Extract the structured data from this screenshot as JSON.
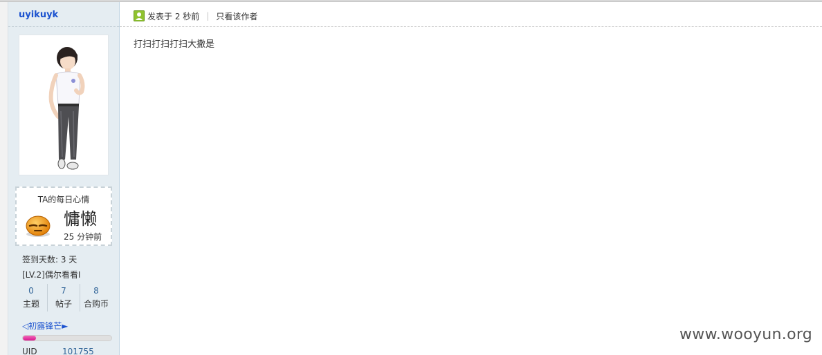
{
  "author": {
    "username": "uyikuyk"
  },
  "mood": {
    "title": "TA的每日心情",
    "word": "慵懒",
    "time": "25 分钟前",
    "icon": "lazy-face-icon"
  },
  "profile": {
    "checkin": "签到天数: 3 天",
    "level": "[LV.2]偶尔看看I",
    "stats": [
      {
        "value": "0",
        "label": "主题"
      },
      {
        "value": "7",
        "label": "帖子"
      },
      {
        "value": "8",
        "label": "合购币"
      }
    ],
    "medal": "◁初露锋芒►",
    "progress_fraction": 0.15,
    "uid_label": "UID",
    "uid_value": "101755"
  },
  "post": {
    "posted_at": "发表于 2 秒前",
    "separator": "|",
    "only_author": "只看该作者",
    "content": "打扫打扫打扫大撒是"
  },
  "watermark": "www.wooyun.org",
  "colors": {
    "sidebar_bg": "#e5edf2",
    "username": "#1b52cf",
    "stat_number": "#336699",
    "progress": "#d9178f"
  }
}
